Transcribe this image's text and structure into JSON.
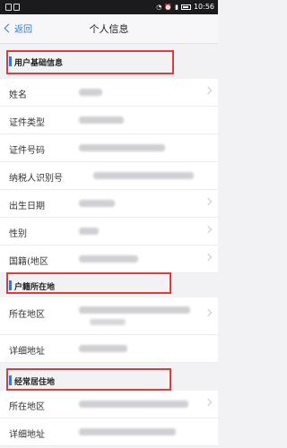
{
  "nav": {
    "back_label": "返回",
    "title": "个人信息"
  },
  "status_bar": {
    "time": "10:56"
  },
  "sections": {
    "basic": {
      "title": "用户基础信息",
      "rows": [
        {
          "label": "姓名"
        },
        {
          "label": "证件类型"
        },
        {
          "label": "证件号码"
        },
        {
          "label": "纳税人识别号"
        },
        {
          "label": "出生日期"
        },
        {
          "label": "性别"
        },
        {
          "label": "国籍(地区"
        }
      ]
    },
    "household": {
      "title": "户籍所在地",
      "rows": [
        {
          "label": "所在地区"
        },
        {
          "label": "详细地址"
        }
      ]
    },
    "residence": {
      "title": "经常居住地",
      "rows": [
        {
          "label": "所在地区"
        },
        {
          "label": "详细地址"
        }
      ]
    }
  },
  "colors": {
    "accent": "#2f7bd6",
    "highlight_box": "#e23a3a"
  }
}
